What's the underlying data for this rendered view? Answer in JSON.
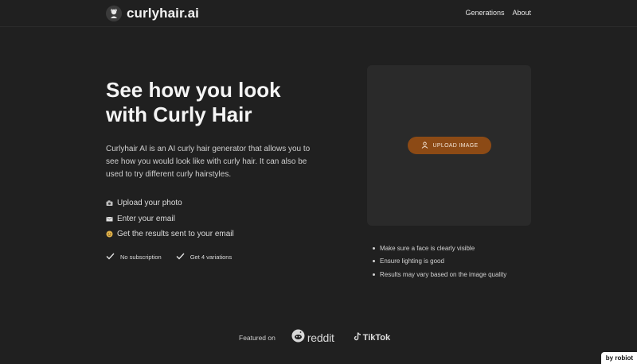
{
  "header": {
    "brand": "curlyhair.ai",
    "nav": [
      {
        "label": "Generations"
      },
      {
        "label": "About"
      }
    ]
  },
  "hero": {
    "title_line1": "See how you look",
    "title_line2": "with Curly Hair",
    "description": "Curlyhair AI is an AI curly hair generator that allows you to see how you would look like with curly hair. It can also be used to try different curly hairstyles.",
    "steps": [
      {
        "icon": "camera-icon",
        "label": "Upload your photo"
      },
      {
        "icon": "envelope-icon",
        "label": "Enter your email"
      },
      {
        "icon": "face-emoji-icon",
        "label": "Get the results sent to your email"
      }
    ],
    "checks": [
      {
        "label": "No subscription"
      },
      {
        "label": "Get 4 variations"
      }
    ]
  },
  "upload": {
    "button_label": "UPLOAD IMAGE",
    "tips": [
      "Make sure a face is clearly visible",
      "Ensure lighting is good",
      "Results may vary based on the image quality"
    ]
  },
  "featured": {
    "label": "Featured on",
    "reddit": "reddit",
    "tiktok": "TikTok"
  },
  "badge": "by robiot",
  "colors": {
    "background": "#202020",
    "panel": "#2a2a2a",
    "accent": "#8c4a15"
  }
}
